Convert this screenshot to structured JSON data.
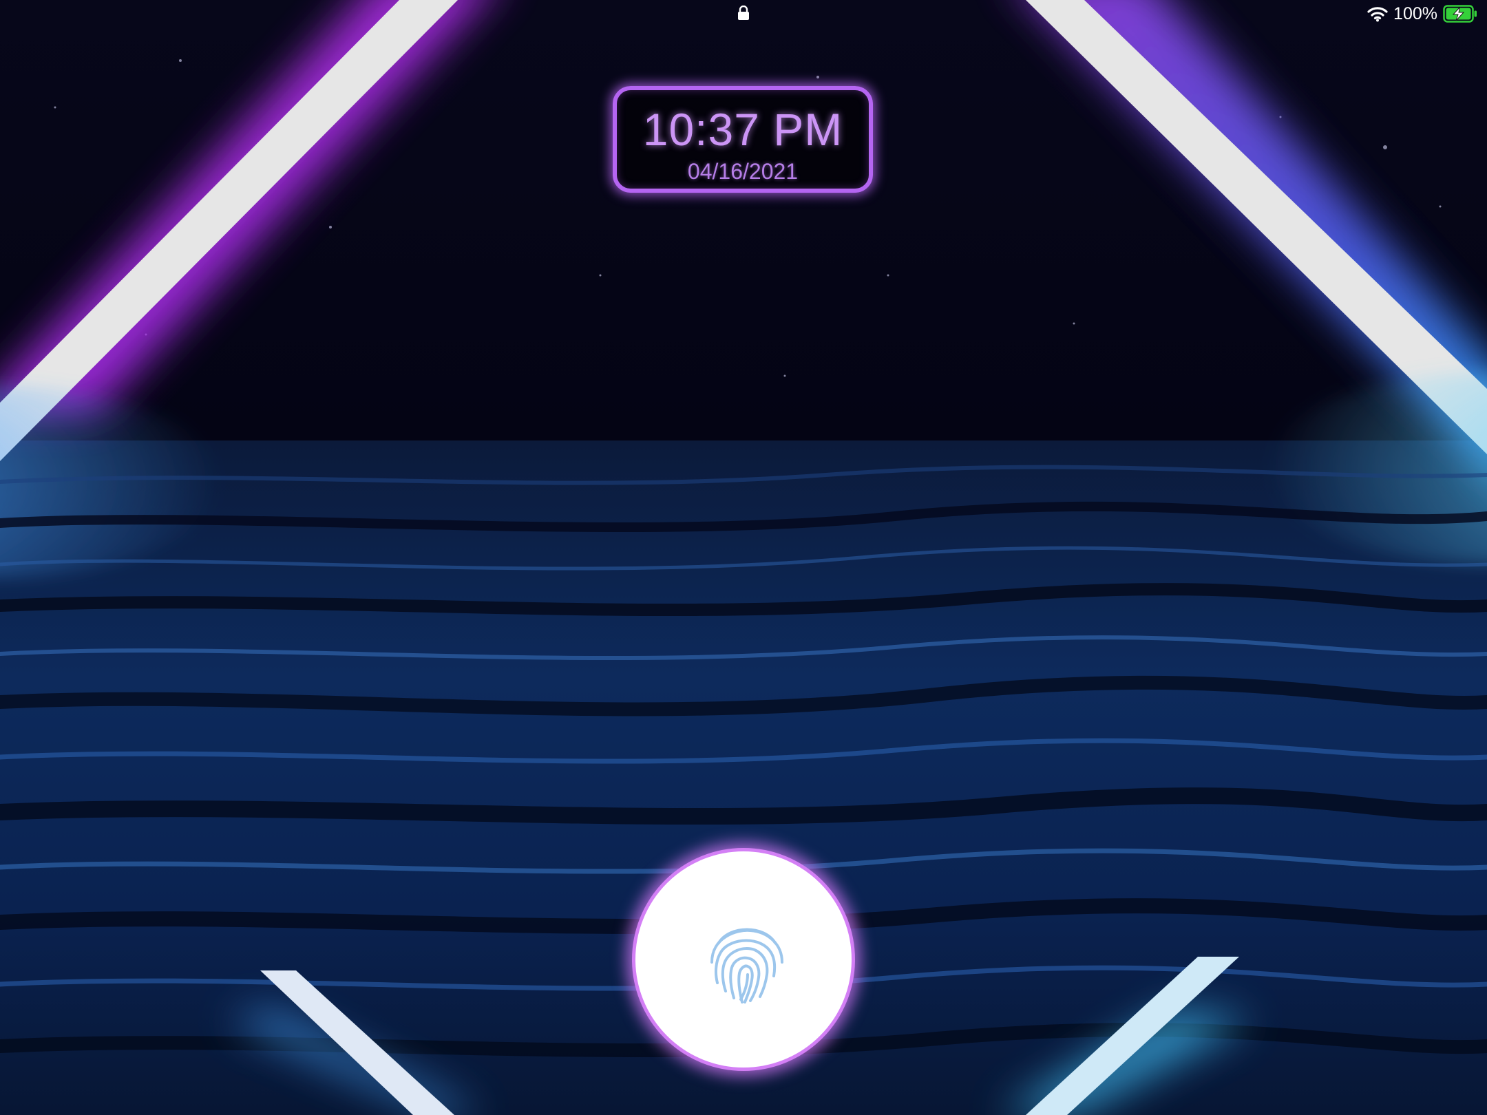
{
  "status_bar": {
    "lock_icon": "lock-icon",
    "wifi_icon": "wifi-icon",
    "battery_percent": "100%",
    "battery_icon": "battery-charging-icon",
    "battery_color": "#35d13a"
  },
  "clock_widget": {
    "time": "10:37 PM",
    "date": "04/16/2021",
    "accent_color": "#b565f2"
  },
  "unlock": {
    "icon": "fingerprint-icon",
    "icon_color": "#8fbfe8",
    "ring_color": "#d37ff5"
  }
}
